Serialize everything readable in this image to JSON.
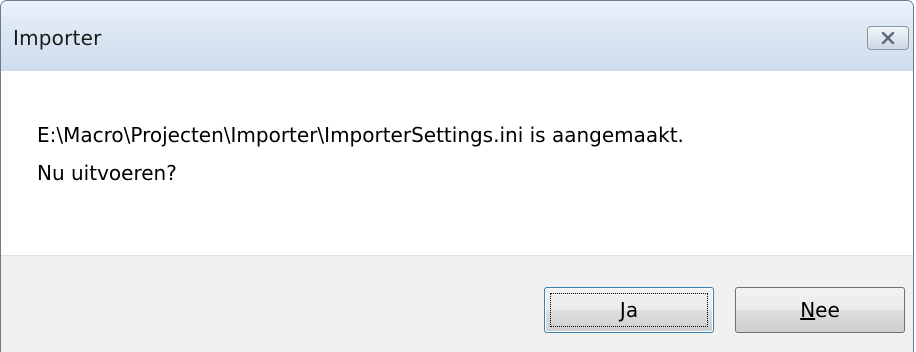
{
  "window": {
    "title": "Importer",
    "close_icon": "close-icon"
  },
  "message": {
    "line1": "E:\\Macro\\Projecten\\Importer\\ImporterSettings.ini is aangemaakt.",
    "line2": "Nu uitvoeren?"
  },
  "buttons": {
    "yes": {
      "mnemonic": "J",
      "rest": "a"
    },
    "no": {
      "mnemonic": "N",
      "rest": "ee"
    }
  }
}
